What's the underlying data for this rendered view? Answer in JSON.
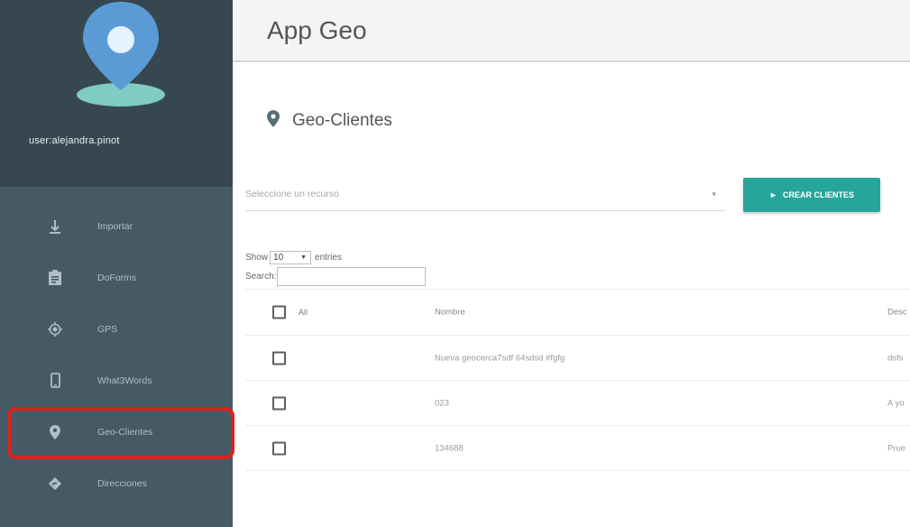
{
  "app": {
    "title": "App Geo"
  },
  "user": {
    "username": "user:alejandra.pinot"
  },
  "sidebar": {
    "items": [
      {
        "label": "Importar",
        "icon": "download-icon"
      },
      {
        "label": "DoForms",
        "icon": "clipboard-icon"
      },
      {
        "label": "GPS",
        "icon": "gps-icon"
      },
      {
        "label": "What3Words",
        "icon": "phone-icon"
      },
      {
        "label": "Geo-Clientes",
        "icon": "map-pin-icon"
      },
      {
        "label": "Direcciones",
        "icon": "directions-icon"
      }
    ],
    "highlighted": "Geo-Clientes"
  },
  "main": {
    "section_title": "Geo-Clientes",
    "resource_select": {
      "placeholder": "Seleccione un recurso"
    },
    "create_button": "CREAR CLIENTES",
    "show_label": "Show",
    "entries_label": "entries",
    "page_length": "10",
    "search_label": "Search:"
  },
  "table": {
    "columns": {
      "all": "All",
      "nombre": "Nombre",
      "descripcion": "Desc"
    },
    "rows": [
      {
        "nombre": "Nueva geocerca7sdf 64sdsd #fgfg",
        "descripcion": "dsfs"
      },
      {
        "nombre": "023",
        "descripcion": "A yo"
      },
      {
        "nombre": "134688",
        "descripcion": "Prue"
      }
    ]
  },
  "colors": {
    "sidebar_bg": "#455a64",
    "profile_bg": "#37474f",
    "accent": "#26a69a",
    "pin_blue": "#5b9bd5",
    "pin_base": "#80cbc4",
    "highlight_border": "#e0201e"
  }
}
